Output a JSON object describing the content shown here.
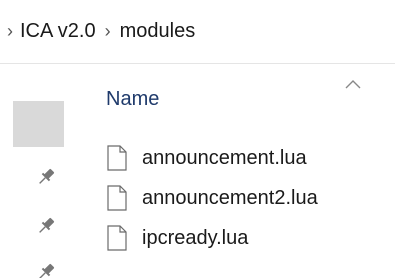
{
  "breadcrumb": {
    "items": [
      "ICA v2.0",
      "modules"
    ],
    "separator": "›"
  },
  "columns": {
    "name_label": "Name",
    "sort_icon": "chevron-up-icon"
  },
  "files": [
    {
      "name": "announcement.lua",
      "icon": "file-icon"
    },
    {
      "name": "announcement2.lua",
      "icon": "file-icon"
    },
    {
      "name": "ipcready.lua",
      "icon": "file-icon"
    }
  ],
  "nav": {
    "pinned_icon": "pin-icon",
    "pinned_count": 3
  },
  "colors": {
    "header_text": "#1f3a6b",
    "selection": "#d9d9d9",
    "text": "#1a1a1a"
  }
}
